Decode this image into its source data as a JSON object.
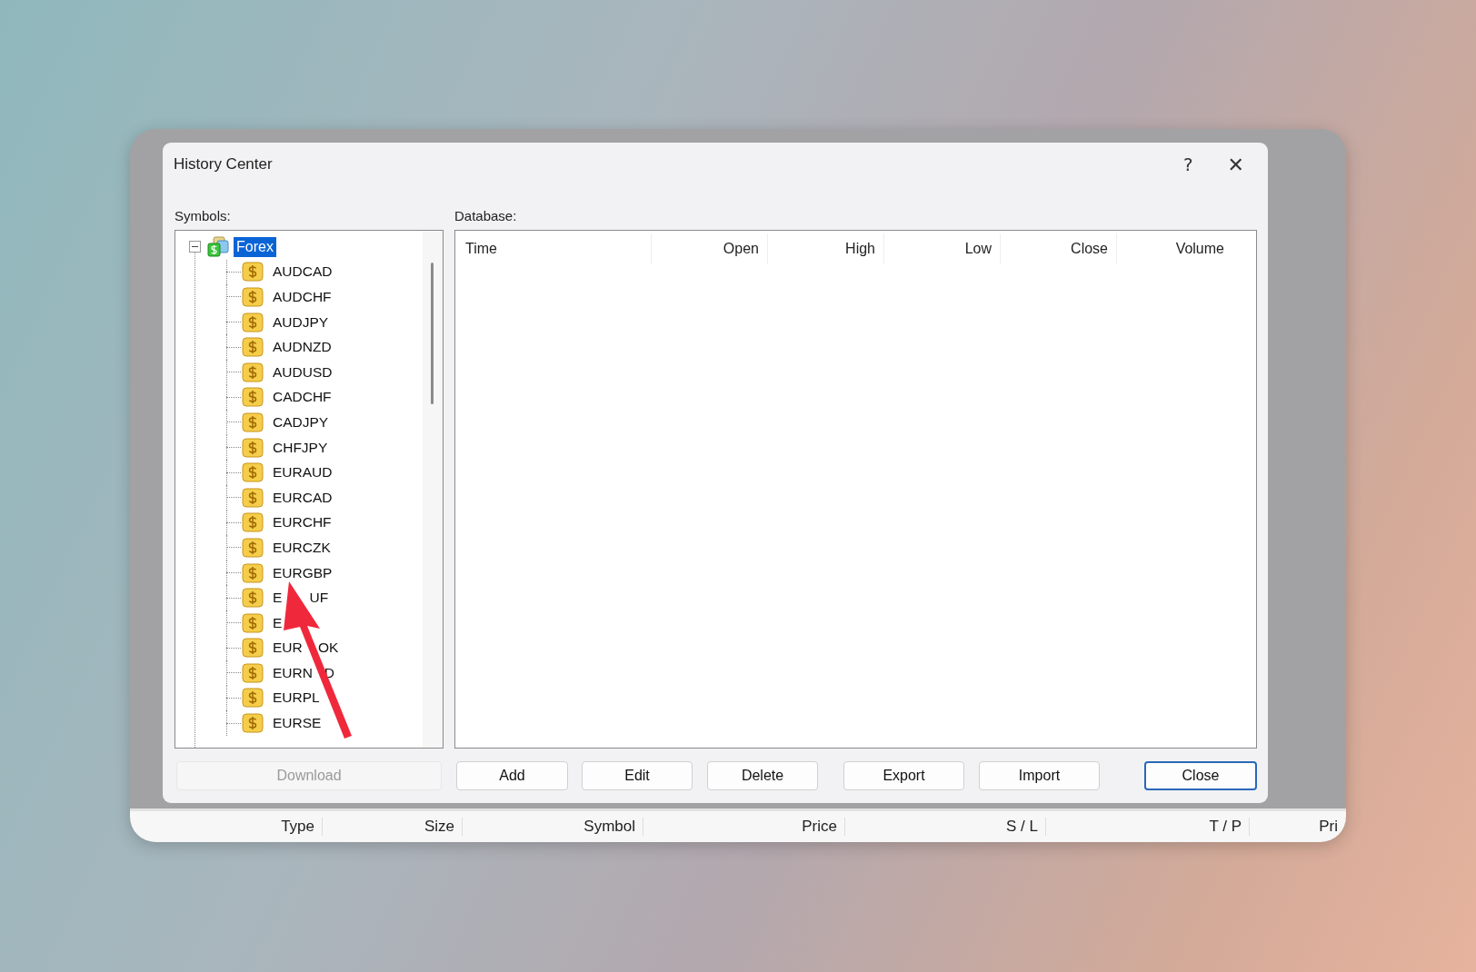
{
  "window": {
    "title": "History Center"
  },
  "title_buttons": [
    {
      "kind": "help",
      "label": "?"
    },
    {
      "kind": "close",
      "label": "✕"
    }
  ],
  "symbols": {
    "label": "Symbols:",
    "tree": [
      {
        "label": "Forex",
        "selected": true,
        "expanded": true,
        "children": [
          {
            "label": "AUDCAD",
            "selected": false
          },
          {
            "label": "AUDCHF",
            "selected": false
          },
          {
            "label": "AUDJPY",
            "selected": false
          },
          {
            "label": "AUDNZD",
            "selected": false
          },
          {
            "label": "AUDUSD",
            "selected": false
          },
          {
            "label": "CADCHF",
            "selected": false
          },
          {
            "label": "CADJPY",
            "selected": false
          },
          {
            "label": "CHFJPY",
            "selected": false
          },
          {
            "label": "EURAUD",
            "selected": false
          },
          {
            "label": "EURCAD",
            "selected": false
          },
          {
            "label": "EURCHF",
            "selected": false
          },
          {
            "label": "EURCZK",
            "selected": false
          },
          {
            "label": "EURGBP",
            "selected": false
          },
          {
            "label": "E       UF",
            "selected": false
          },
          {
            "label": "E",
            "selected": false
          },
          {
            "label": "EUR    OK",
            "selected": false
          },
          {
            "label": "EURN   D",
            "selected": false
          },
          {
            "label": "EURPL",
            "selected": false
          },
          {
            "label": "EURSE",
            "selected": false
          }
        ]
      }
    ]
  },
  "database": {
    "label": "Database:",
    "columns": [
      "Time",
      "Open",
      "High",
      "Low",
      "Close",
      "Volume"
    ]
  },
  "buttons": [
    {
      "label": "Download",
      "disabled": true,
      "default": false
    },
    {
      "label": "Add",
      "disabled": false,
      "default": false
    },
    {
      "label": "Edit",
      "disabled": false,
      "default": false
    },
    {
      "label": "Delete",
      "disabled": false,
      "default": false
    },
    {
      "label": "Export",
      "disabled": false,
      "default": false
    },
    {
      "label": "Import",
      "disabled": false,
      "default": false
    },
    {
      "label": "Close",
      "disabled": false,
      "default": true
    }
  ],
  "background_table": {
    "columns": [
      "Type",
      "Size",
      "Symbol",
      "Price",
      "S / L",
      "T / P",
      "Pri"
    ]
  }
}
